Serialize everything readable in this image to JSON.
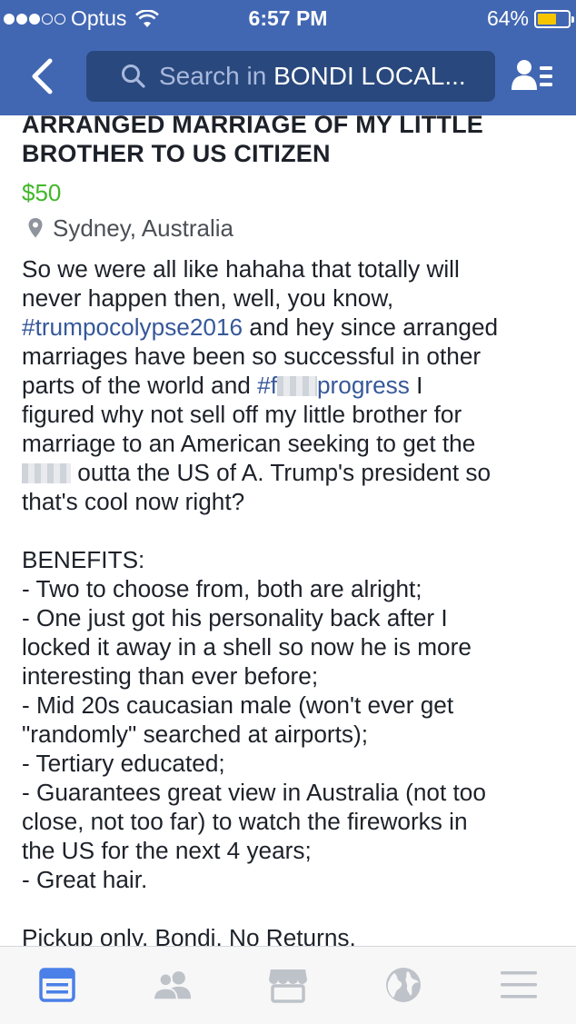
{
  "status_bar": {
    "carrier": "Optus",
    "time": "6:57 PM",
    "battery_percent": "64%",
    "battery_level": 0.64,
    "signal_bars_filled": 3,
    "signal_bars_total": 5
  },
  "nav": {
    "back_icon": "chevron-left-icon",
    "search_prefix": "Search in ",
    "search_group": "BONDI LOCAL...",
    "friends_icon": "friend-requests-icon"
  },
  "listing": {
    "title_lines": [
      "ARRANGED MARRIAGE OF MY LITTLE",
      "BROTHER TO US CITIZEN"
    ],
    "price": "$50",
    "location": "Sydney, Australia",
    "description": {
      "l1": "So we were all like hahaha that totally will",
      "l2": "never happen then, well, you know,",
      "l3_tag": "#trumpocolypse2016",
      "l3_rest": " and hey since arranged",
      "l4": "marriages have been so successful in other",
      "l5_pre": "parts of the world and ",
      "l5_tag_a": "#f",
      "l5_tag_b": "progress",
      "l5_post": " I",
      "l6": "figured why not sell off my little brother for",
      "l7": "marriage to an American seeking to get the",
      "l8_rest": " outta the US of A. Trump's president so",
      "l9": "that's cool now right?",
      "benefits_heading": "BENEFITS:",
      "b1": "- Two to choose from, both are alright;",
      "b2": "- One just got his personality back after I",
      "b3": "locked it away in a shell so now he is more",
      "b4": "interesting than ever before;",
      "b5": "- Mid 20s caucasian male (won't ever get",
      "b6": "\"randomly\" searched at airports);",
      "b7": "- Tertiary educated;",
      "b8": "- Guarantees great view in Australia (not too",
      "b9": "close, not too far) to watch the fireworks in",
      "b10": "the US for the next 4 years;",
      "b11": "- Great hair.",
      "footer": "Pickup only. Bondi. No Returns."
    }
  },
  "tabbar": {
    "tabs": [
      "news-feed-icon",
      "friends-icon",
      "marketplace-icon",
      "globe-icon",
      "menu-icon"
    ],
    "active_tab": "news-feed-icon"
  },
  "colors": {
    "brand_blue": "#4267b2",
    "search_bg": "#29487d",
    "price_green": "#42b72a",
    "hashtag_blue": "#365899",
    "battery_yellow": "#f7c500",
    "active_tab": "#4a80e8",
    "inactive_tab": "#bec2c9"
  }
}
